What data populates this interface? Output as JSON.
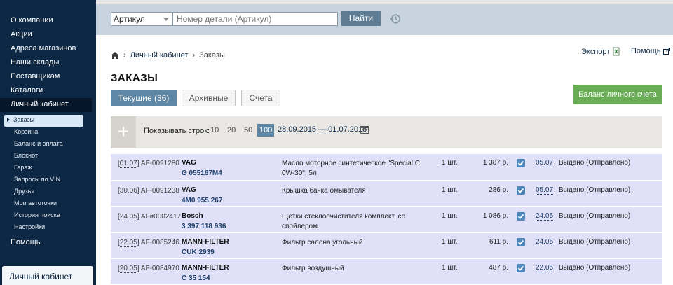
{
  "sidebar": {
    "items": [
      {
        "label": "О компании"
      },
      {
        "label": "Акции"
      },
      {
        "label": "Адреса магазинов"
      },
      {
        "label": "Наши склады"
      },
      {
        "label": "Поставщикам"
      },
      {
        "label": "Каталоги"
      },
      {
        "label": "Личный кабинет"
      }
    ],
    "sub_items": [
      {
        "label": "Заказы"
      },
      {
        "label": "Корзина"
      },
      {
        "label": "Баланс и оплата"
      },
      {
        "label": "Блокнот"
      },
      {
        "label": "Гараж"
      },
      {
        "label": "Запросы по VIN"
      },
      {
        "label": "Друзья"
      },
      {
        "label": "Мои автоточки"
      },
      {
        "label": "История поиска"
      },
      {
        "label": "Настройки"
      }
    ],
    "help": "Помощь",
    "panel_title": "Личный кабинет"
  },
  "search": {
    "type_selected": "Артикул",
    "placeholder": "Номер детали (Артикул)",
    "button_label": "Найти"
  },
  "breadcrumb": {
    "items": [
      "Личный кабинет",
      "Заказы"
    ]
  },
  "header_links": {
    "export": "Экспорт",
    "help": "Помощь"
  },
  "page_title": "ЗАКАЗЫ",
  "tabs": [
    {
      "label": "Текущие (36)",
      "active": true
    },
    {
      "label": "Архивные",
      "active": false
    },
    {
      "label": "Счета",
      "active": false
    }
  ],
  "balance_button": "Баланс личного счета",
  "filter": {
    "plus": "+",
    "rows_label": "Показывать строк:",
    "row_options": [
      "10",
      "20",
      "50",
      "100"
    ],
    "selected_rows": "100",
    "date_range": "28.09.2015 — 01.07.2016"
  },
  "orders": [
    {
      "date": "01.07",
      "order_no": "AF-0091280",
      "brand": "VAG",
      "part_no": "G 055167M4",
      "description": "Масло моторное синтетическое \"Special C 0W-30\", 5л",
      "qty": "1 шт.",
      "price": "1 387 р.",
      "delivery": "05.07",
      "status": "Выдано (Отправлено)"
    },
    {
      "date": "30.06",
      "order_no": "AF-0091238",
      "brand": "VAG",
      "part_no": "4M0 955 267",
      "description": "Крышка бачка омывателя",
      "qty": "1 шт.",
      "price": "286 р.",
      "delivery": "05.07",
      "status": "Выдано (Отправлено)"
    },
    {
      "date": "24.05",
      "order_no": "AF#0002417",
      "brand": "Bosch",
      "part_no": "3 397 118 936",
      "description": "Щётки стеклоочистителя комплект, со спойлером",
      "qty": "1 шт.",
      "price": "1 086 р.",
      "delivery": "24.05",
      "status": "Выдано (Отправлено)"
    },
    {
      "date": "22.05",
      "order_no": "AF-0085246",
      "brand": "MANN-FILTER",
      "part_no": "CUK 2939",
      "description": "Фильтр салона угольный",
      "qty": "1 шт.",
      "price": "611 р.",
      "delivery": "24.05",
      "status": "Выдано (Отправлено)"
    },
    {
      "date": "20.05",
      "order_no": "AF-0084970",
      "brand": "MANN-FILTER",
      "part_no": "C 35 154",
      "description": "Фильтр воздушный",
      "qty": "1 шт.",
      "price": "487 р.",
      "delivery": "22.05",
      "status": "Выдано (Отправлено)"
    }
  ],
  "colors": {
    "sidebar": "#0d2845",
    "accent": "#5e87a5",
    "row_bg": "#e0e0f8",
    "balance": "#6aab55"
  }
}
